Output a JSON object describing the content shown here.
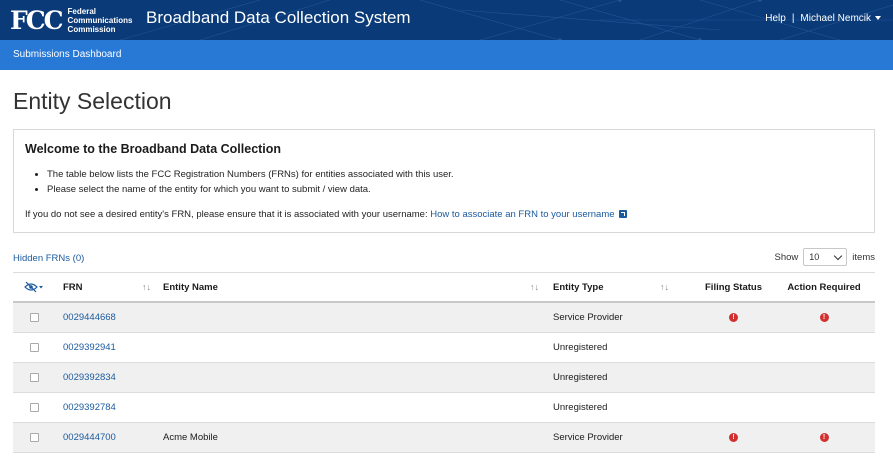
{
  "header": {
    "logo_mark": "FCC",
    "logo_lines": [
      "Federal",
      "Communications",
      "Commission"
    ],
    "app_title": "Broadband Data Collection System",
    "help_label": "Help",
    "separator": "|",
    "user_name": "Michael Nemcik"
  },
  "nav": {
    "dashboard_label": "Submissions Dashboard"
  },
  "page": {
    "title": "Entity Selection"
  },
  "welcome": {
    "heading": "Welcome to the Broadband Data Collection",
    "bullets": [
      "The table below lists the FCC Registration Numbers (FRNs) for entities associated with this user.",
      "Please select the name of the entity for which you want to submit / view data."
    ],
    "help_text": "If you do not see a desired entity's FRN, please ensure that it is associated with your username:",
    "help_link": "How to associate an FRN to your username"
  },
  "table_controls": {
    "hidden_frns": "Hidden FRNs (0)",
    "show_label": "Show",
    "page_size": "10",
    "items_label": "items"
  },
  "table": {
    "columns": {
      "frn": "FRN",
      "entity_name": "Entity Name",
      "entity_type": "Entity Type",
      "filing_status": "Filing Status",
      "action_required": "Action Required"
    },
    "sort_glyph": "↑↓",
    "alert_glyph": "!",
    "rows": [
      {
        "frn": "0029444668",
        "entity_name": "",
        "entity_type": "Service Provider",
        "filing_alert": true,
        "action_alert": true
      },
      {
        "frn": "0029392941",
        "entity_name": "",
        "entity_type": "Unregistered",
        "filing_alert": false,
        "action_alert": false
      },
      {
        "frn": "0029392834",
        "entity_name": "",
        "entity_type": "Unregistered",
        "filing_alert": false,
        "action_alert": false
      },
      {
        "frn": "0029392784",
        "entity_name": "",
        "entity_type": "Unregistered",
        "filing_alert": false,
        "action_alert": false
      },
      {
        "frn": "0029444700",
        "entity_name": "Acme Mobile",
        "entity_type": "Service Provider",
        "filing_alert": true,
        "action_alert": true
      }
    ]
  },
  "colors": {
    "header_bg": "#0a3a78",
    "nav_bg": "#2878d6",
    "link": "#1a5a9e",
    "alert": "#d22f2f",
    "row_shade": "#f0f0f0"
  },
  "icons": {
    "hide_column": "eye-slash-icon",
    "external_link": "external-link-icon",
    "alert": "alert-circle-icon",
    "dropdown": "chevron-down-icon"
  }
}
